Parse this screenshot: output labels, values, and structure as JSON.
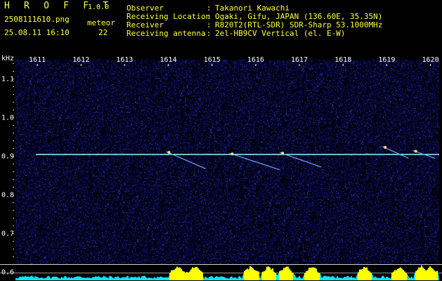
{
  "header": {
    "logo": "H R O F F T",
    "version": "1.0.0",
    "filename": "2508111610.png",
    "datetime": "25.08.11 16:10",
    "meteor_label": "meteor",
    "meteor_count": "22",
    "info": [
      {
        "label": "Observer",
        "value": "Takanori Kawachi"
      },
      {
        "label": "Receiving Location",
        "value": "Ogaki, Gifu, JAPAN (136.60E, 35.35N)"
      },
      {
        "label": "Receiver",
        "value": "R820T2(RTL-SDR) SDR-Sharp 53.1000MHz"
      },
      {
        "label": "Receiving antenna",
        "value": "2el-HB9CV Vertical (el. E-W)"
      }
    ]
  },
  "colors": {
    "background": "#000000",
    "noise": "#1a1a8a",
    "carrier": "#a0ffff",
    "echo": "#ffe060",
    "histogram_cyan": "#00e8ff",
    "histogram_yellow": "#ffff00",
    "axis_text": "#ffffff",
    "header_text": "#ffff40"
  },
  "chart_data": {
    "type": "heatmap",
    "xlabel": "",
    "ylabel": "kHz",
    "x_ticks": [
      "1611",
      "1612",
      "1613",
      "1614",
      "1615",
      "1616",
      "1617",
      "1618",
      "1619",
      "1620"
    ],
    "x_range": [
      1610.5,
      1620.2
    ],
    "y_ticks": [
      "1.1",
      "1.0",
      "0.9",
      "0.8",
      "0.7",
      "0.6"
    ],
    "y_range": [
      0.59,
      1.15
    ],
    "carrier_frequency_khz": 0.905,
    "meteor_echoes": [
      {
        "start_min": 1613.95,
        "end_min": 1614.85,
        "start_khz": 0.912,
        "end_khz": 0.868
      },
      {
        "start_min": 1615.4,
        "end_min": 1616.55,
        "start_khz": 0.908,
        "end_khz": 0.865
      },
      {
        "start_min": 1616.55,
        "end_min": 1617.5,
        "start_khz": 0.91,
        "end_khz": 0.872
      },
      {
        "start_min": 1618.9,
        "end_min": 1619.5,
        "start_khz": 0.925,
        "end_khz": 0.895
      },
      {
        "start_min": 1619.6,
        "end_min": 1620.1,
        "start_khz": 0.915,
        "end_khz": 0.895
      }
    ],
    "activity_bursts_min": [
      1614.2,
      1614.6,
      1615.9,
      1616.3,
      1616.7,
      1617.3,
      1618.5,
      1619.3,
      1619.8,
      1620.0
    ]
  }
}
